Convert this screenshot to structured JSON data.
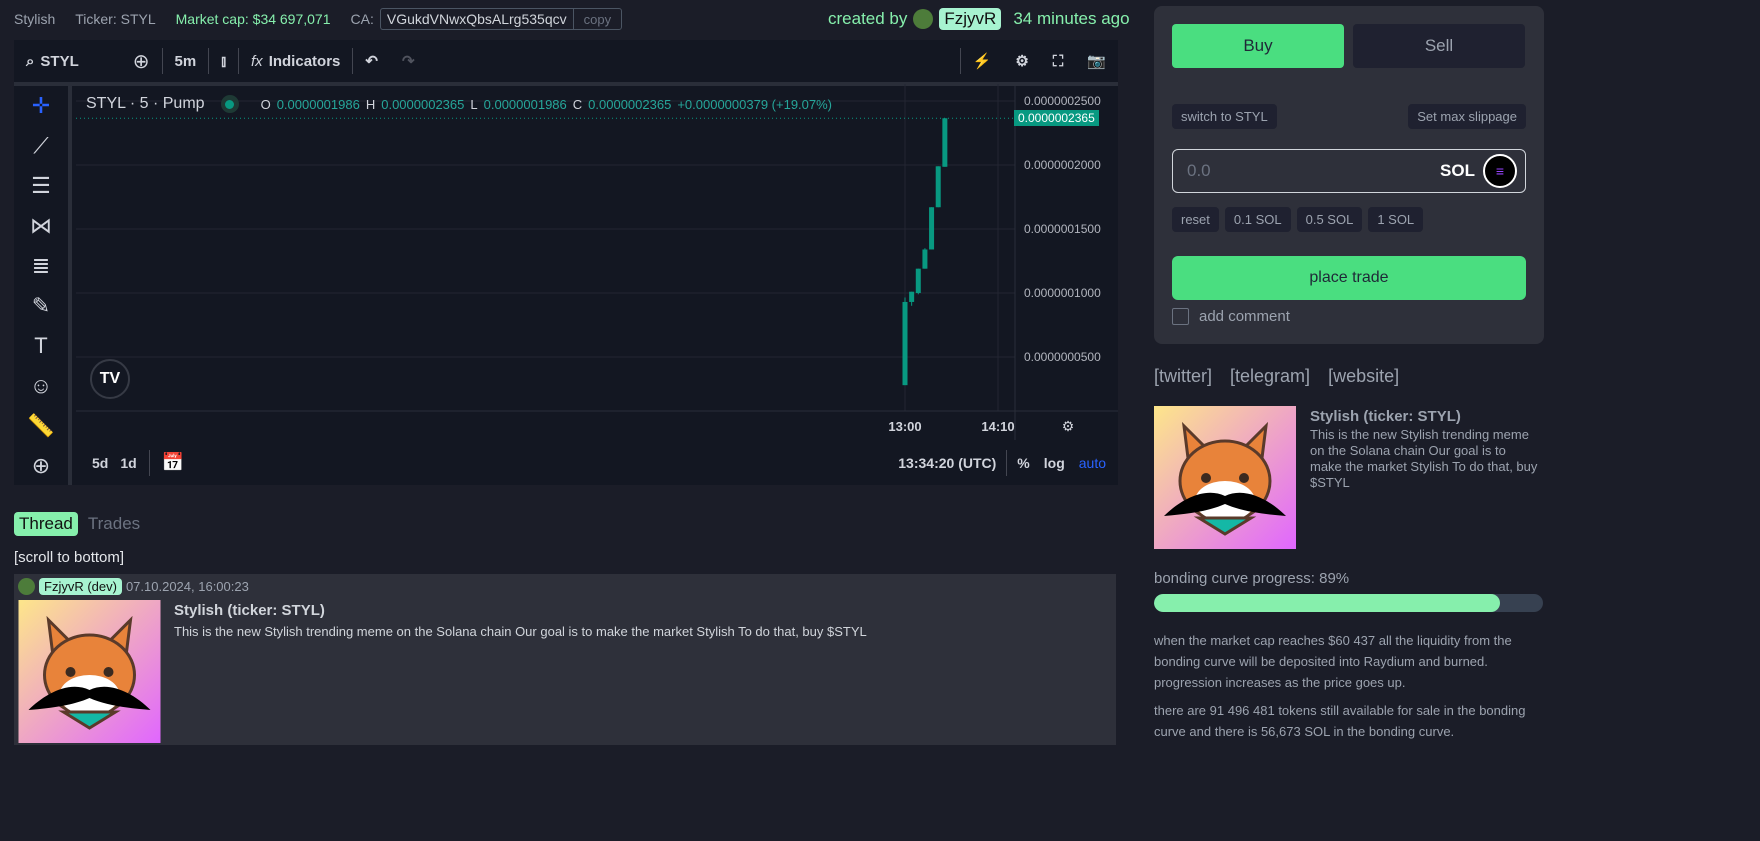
{
  "header": {
    "name": "Stylish",
    "ticker": "Ticker: STYL",
    "market_cap": "Market cap: $34 697,071",
    "ca_label": "CA:",
    "ca_value": "VGukdVNwxQbsALrg535qcv",
    "copy": "copy",
    "created_by": "created by",
    "creator": "FzjyvR",
    "time_ago": "34 minutes ago"
  },
  "chart_toolbar": {
    "symbol": "STYL",
    "interval": "5m",
    "indicators": "Indicators"
  },
  "legend": {
    "title": "STYL · 5 · Pump",
    "o_label": "O",
    "o": "0.0000001986",
    "h_label": "H",
    "h": "0.0000002365",
    "l_label": "L",
    "l": "0.0000001986",
    "c_label": "C",
    "c": "0.0000002365",
    "change": "+0.0000000379 (+19.07%)"
  },
  "chart_bottom": {
    "range_5d": "5d",
    "range_1d": "1d",
    "clock": "13:34:20 (UTC)",
    "pct": "%",
    "log": "log",
    "auto": "auto"
  },
  "chart_data": {
    "type": "candlestick",
    "y_ticks": [
      "0.0000002500",
      "0.0000002000",
      "0.0000001500",
      "0.0000001000",
      "0.0000000500"
    ],
    "y_tick_values": [
      2.5e-07,
      2e-07,
      1.5e-07,
      1e-07,
      5e-08
    ],
    "x_ticks": [
      "13:00",
      "14:10"
    ],
    "x_tick_minutes": [
      0,
      70
    ],
    "current_price": "0.0000002365",
    "current_value": 2.365e-07,
    "candles": [
      {
        "t": 0,
        "o": 2.8e-08,
        "h": 9.65e-08,
        "l": 2.8e-08,
        "c": 9.3e-08
      },
      {
        "t": 5,
        "o": 9.3e-08,
        "h": 1.01e-07,
        "l": 9e-08,
        "c": 1.01e-07
      },
      {
        "t": 10,
        "o": 1e-07,
        "h": 1.19e-07,
        "l": 9.9e-08,
        "c": 1.19e-07
      },
      {
        "t": 15,
        "o": 1.19e-07,
        "h": 1.35e-07,
        "l": 1.19e-07,
        "c": 1.34e-07
      },
      {
        "t": 20,
        "o": 1.34e-07,
        "h": 1.67e-07,
        "l": 1.34e-07,
        "c": 1.67e-07
      },
      {
        "t": 25,
        "o": 1.67e-07,
        "h": 1.99e-07,
        "l": 1.67e-07,
        "c": 1.99e-07
      },
      {
        "t": 30,
        "o": 1.986e-07,
        "h": 2.365e-07,
        "l": 1.986e-07,
        "c": 2.365e-07
      }
    ]
  },
  "trade": {
    "buy": "Buy",
    "sell": "Sell",
    "switch": "switch to STYL",
    "max_slippage": "Set max slippage",
    "amount_placeholder": "0.0",
    "currency": "SOL",
    "presets": [
      "reset",
      "0.1 SOL",
      "0.5 SOL",
      "1 SOL"
    ],
    "place": "place trade",
    "add_comment": "add comment"
  },
  "links": [
    "[twitter]",
    "[telegram]",
    "[website]"
  ],
  "token": {
    "title": "Stylish (ticker: STYL)",
    "description": "This is the new Stylish trending meme on the Solana chain Our goal is to make the market Stylish To do that, buy $STYL"
  },
  "bonding": {
    "label": "bonding curve progress: 89%",
    "progress": 89,
    "text1": "when the market cap reaches $60 437 all the liquidity from the bonding curve will be deposited into Raydium and burned. progression increases as the price goes up.",
    "text2": "there are 91 496 481 tokens still available for sale in the bonding curve and there is 56,673 SOL in the bonding curve."
  },
  "thread": {
    "tab_thread": "Thread",
    "tab_trades": "Trades",
    "scroll": "[scroll to bottom]",
    "post": {
      "author": "FzjyvR (dev)",
      "date": "07.10.2024, 16:00:23",
      "title": "Stylish (ticker: STYL)",
      "body": "This is the new Stylish trending meme on the Solana chain Our goal is to make the market Stylish To do that, buy $STYL"
    }
  },
  "colors": {
    "up": "#089981",
    "accent": "#86efac",
    "buy": "#4ade80"
  }
}
